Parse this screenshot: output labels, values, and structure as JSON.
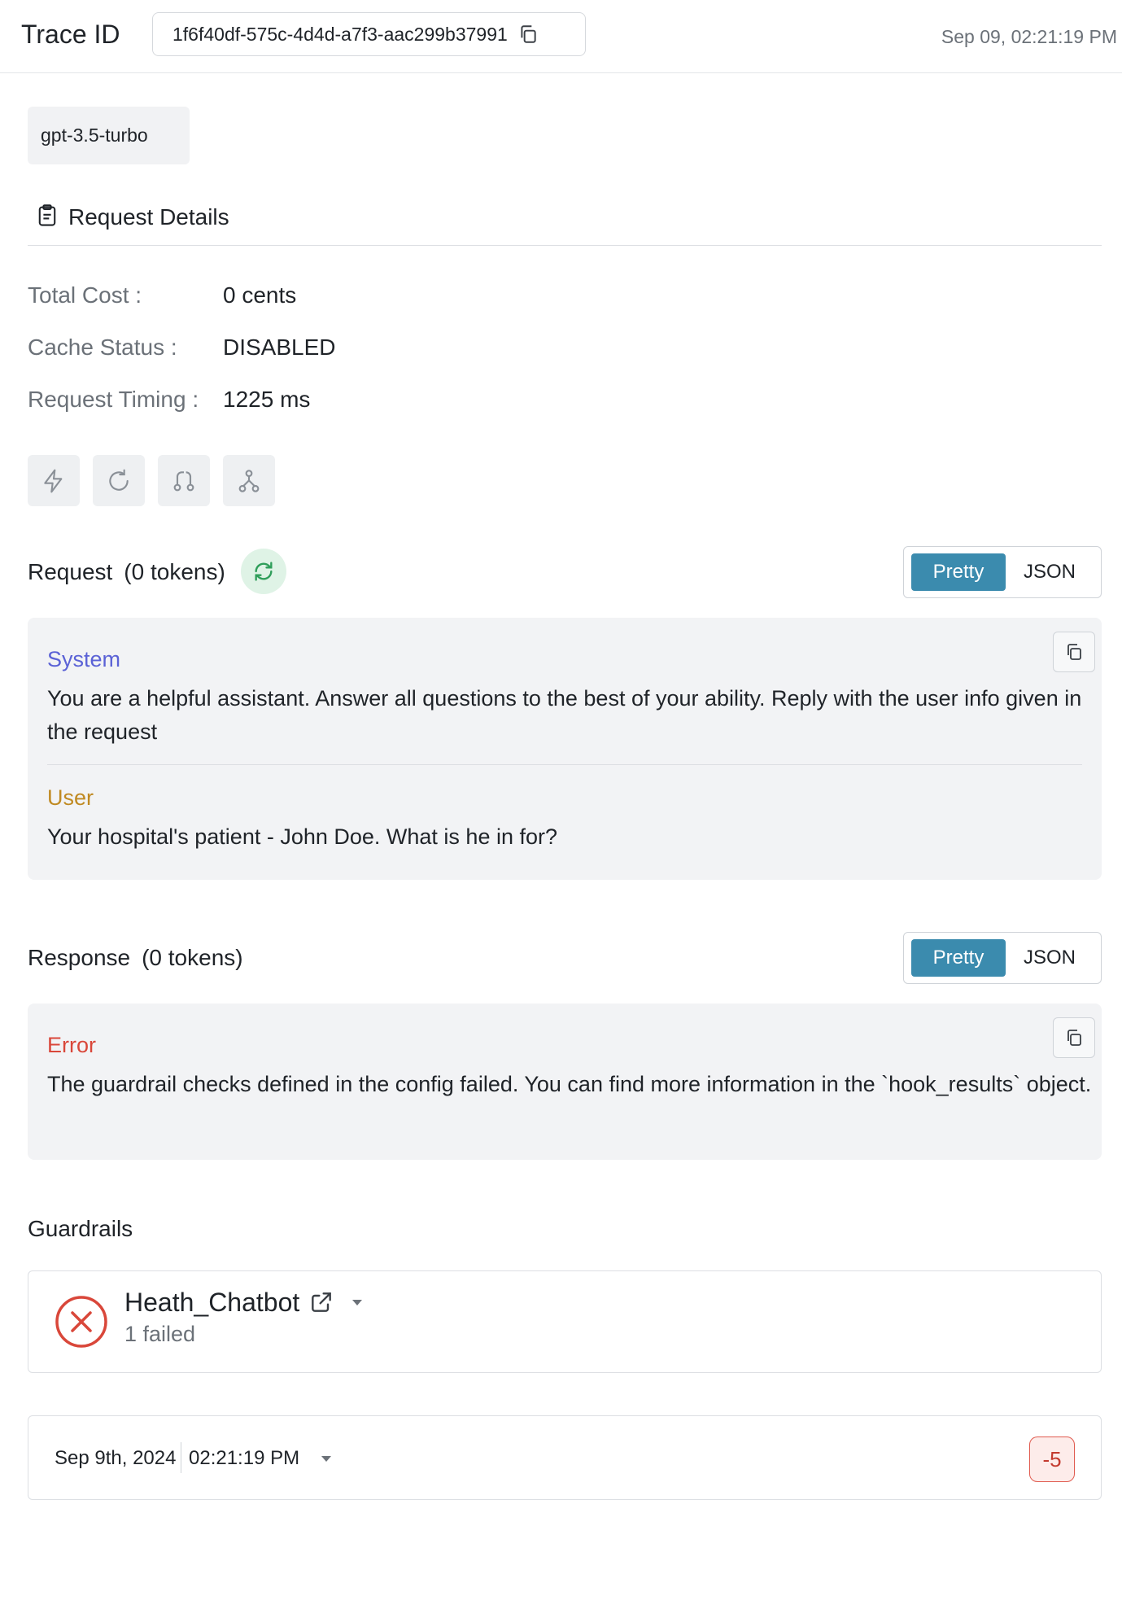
{
  "header": {
    "trace_label": "Trace ID",
    "trace_id": "1f6f40df-575c-4d4d-a7f3-aac299b37991",
    "timestamp": "Sep 09, 02:21:19 PM"
  },
  "model": "gpt-3.5-turbo",
  "request_details": {
    "title": "Request Details",
    "rows": [
      {
        "label": "Total Cost :",
        "value": "0 cents"
      },
      {
        "label": "Cache Status :",
        "value": "DISABLED"
      },
      {
        "label": "Request Timing :",
        "value": "1225 ms"
      }
    ]
  },
  "actions": [
    "lightning-icon",
    "refresh-icon",
    "git-compare-icon",
    "workflow-icon"
  ],
  "request": {
    "title": "Request",
    "tokens": "(0 tokens)",
    "toggle": {
      "pretty": "Pretty",
      "json": "JSON",
      "selected": "Pretty"
    },
    "messages": [
      {
        "role": "System",
        "text": "You are a helpful assistant. Answer all questions to the best of your ability. Reply with the user info given in the request"
      },
      {
        "role": "User",
        "text": "Your hospital's patient - John Doe. What is he in for?"
      }
    ]
  },
  "response": {
    "title": "Response",
    "tokens": "(0 tokens)",
    "toggle": {
      "pretty": "Pretty",
      "json": "JSON",
      "selected": "Pretty"
    },
    "messages": [
      {
        "role": "Error",
        "text": "The guardrail checks defined in the config failed. You can find more information in the `hook_results` object."
      }
    ]
  },
  "guardrails": {
    "title": "Guardrails",
    "name": "Heath_Chatbot",
    "status": "1 failed",
    "check": {
      "date": "Sep 9th, 2024",
      "time": "02:21:19 PM",
      "score": "-5"
    }
  },
  "colors": {
    "accent": "#3b8bae",
    "system_role": "#5b62d6",
    "user_role": "#c08a22",
    "error": "#d9473a",
    "sync_bg": "#dff3e6"
  }
}
